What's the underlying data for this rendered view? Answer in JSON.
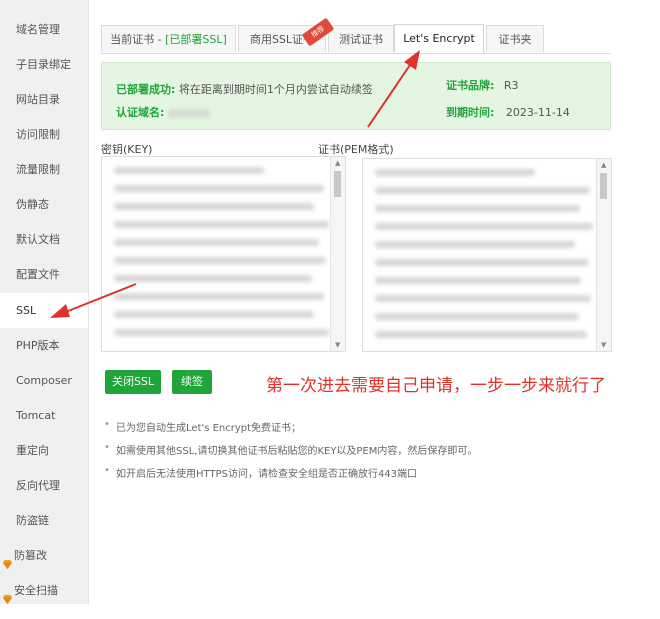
{
  "sidebar": {
    "items": [
      {
        "label": "域名管理"
      },
      {
        "label": "子目录绑定"
      },
      {
        "label": "网站目录"
      },
      {
        "label": "访问限制"
      },
      {
        "label": "流量限制"
      },
      {
        "label": "伪静态"
      },
      {
        "label": "默认文档"
      },
      {
        "label": "配置文件"
      },
      {
        "label": "SSL"
      },
      {
        "label": "PHP版本"
      },
      {
        "label": "Composer"
      },
      {
        "label": "Tomcat"
      },
      {
        "label": "重定向"
      },
      {
        "label": "反向代理"
      },
      {
        "label": "防盗链"
      },
      {
        "label": "防篡改",
        "icon": "gem-icon"
      },
      {
        "label": "安全扫描",
        "icon": "gem-icon"
      }
    ],
    "active": "SSL"
  },
  "tabs": {
    "current_prefix": "当前证书 - ",
    "current_status": "[已部署SSL]",
    "commercial": "商用SSL证书",
    "commercial_badge": "推荐",
    "test": "测试证书",
    "letsencrypt": "Let's Encrypt",
    "folder": "证书夹",
    "active": "Let's Encrypt"
  },
  "status": {
    "deployed_label": "已部署成功:",
    "deployed_text": "将在距离到期时间1个月内尝试自动续签",
    "domain_label": "认证域名:",
    "brand_label": "证书品牌:",
    "brand_value": "R3",
    "expire_label": "到期时间:",
    "expire_value": "2023-11-14"
  },
  "key_label": "密钥(KEY)",
  "cert_label": "证书(PEM格式)",
  "buttons": {
    "close_ssl": "关闭SSL",
    "renew": "续签"
  },
  "annotation": "第一次进去需要自己申请，一步一步来就行了",
  "tips": [
    "已为您自动生成Let's Encrypt免费证书；",
    "如需使用其他SSL,请切换其他证书后粘贴您的KEY以及PEM内容，然后保存即可。",
    "如开启后无法使用HTTPS访问，请检查安全组是否正确放行443端口"
  ],
  "colors": {
    "accent_green": "#20a53a",
    "annotation_red": "#e0322a",
    "status_bg": "#e4f5e1",
    "sidebar_bg": "#f0f0f0"
  }
}
